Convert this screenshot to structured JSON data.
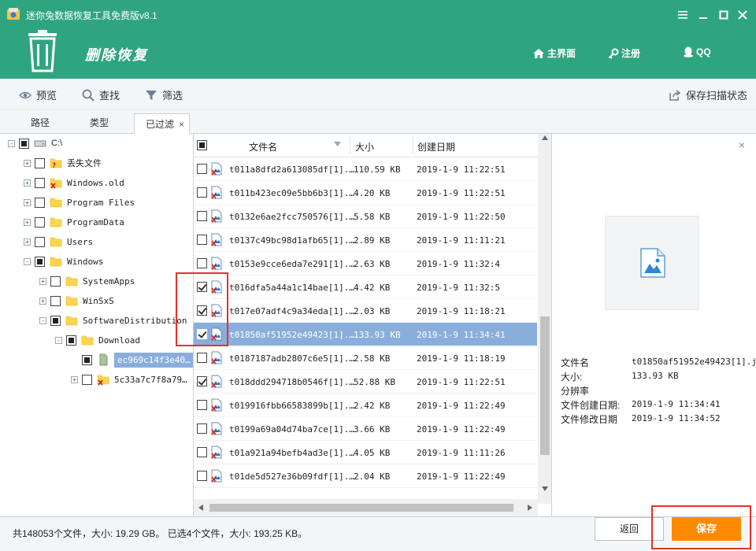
{
  "window": {
    "title": "迷你兔数据恢复工具免费版v8.1",
    "controls": [
      "settings",
      "minimize",
      "maximize",
      "close"
    ]
  },
  "header": {
    "page_title": "删除恢复",
    "nav": [
      {
        "label": "主界面",
        "icon": "home-icon"
      },
      {
        "label": "注册",
        "icon": "key-icon"
      },
      {
        "label": "QQ",
        "icon": "qq-icon"
      }
    ]
  },
  "toolbar": {
    "preview": "预览",
    "find": "查找",
    "filter": "筛选",
    "save_scan": "保存扫描状态"
  },
  "tabs": [
    {
      "label": "路径",
      "active": false
    },
    {
      "label": "类型",
      "active": false
    },
    {
      "label": "已过滤",
      "active": true,
      "closable": "×"
    }
  ],
  "tree": [
    {
      "label": "C:\\",
      "check": "partial",
      "icon": "drive-icon",
      "expander": "-"
    },
    {
      "label": "丢失文件",
      "check": "none",
      "icon": "lost-folder-icon",
      "expander": "+"
    },
    {
      "label": "Windows.old",
      "check": "none",
      "icon": "deleted-folder-icon",
      "expander": "+"
    },
    {
      "label": "Program Files",
      "check": "none",
      "icon": "folder-icon",
      "expander": "+"
    },
    {
      "label": "ProgramData",
      "check": "none",
      "icon": "folder-icon",
      "expander": "+"
    },
    {
      "label": "Users",
      "check": "none",
      "icon": "folder-icon",
      "expander": "+"
    },
    {
      "label": "Windows",
      "check": "partial",
      "icon": "folder-icon",
      "expander": "-"
    },
    {
      "label": "SystemApps",
      "check": "none",
      "icon": "folder-icon",
      "expander": "+"
    },
    {
      "label": "WinSxS",
      "check": "none",
      "icon": "folder-icon",
      "expander": "+"
    },
    {
      "label": "SoftwareDistribution",
      "check": "partial",
      "icon": "folder-icon",
      "expander": "-"
    },
    {
      "label": "Download",
      "check": "partial",
      "icon": "folder-icon",
      "expander": "-"
    },
    {
      "label": "ec969c14f3e40…",
      "check": "partial",
      "icon": "folder-icon",
      "expander": "",
      "selected": true
    },
    {
      "label": "5c33a7c7f8a79…",
      "check": "none",
      "icon": "deleted-folder-icon",
      "expander": "+"
    }
  ],
  "list": {
    "headers": {
      "name": "文件名",
      "size": "大小",
      "date": "创建日期"
    },
    "rows": [
      {
        "name": "t011a8dfd2a613085df[1].…",
        "size": "110.59 KB",
        "date": "2019-1-9  11:22:51",
        "checked": false
      },
      {
        "name": "t011b423ec09e5bb6b3[1].…",
        "size": "4.20 KB",
        "date": "2019-1-9  11:22:51",
        "checked": false
      },
      {
        "name": "t0132e6ae2fcc750576[1].…",
        "size": "5.58 KB",
        "date": "2019-1-9  11:22:50",
        "checked": false
      },
      {
        "name": "t0137c49bc98d1afb65[1].…",
        "size": "2.89 KB",
        "date": "2019-1-9  11:11:21",
        "checked": false
      },
      {
        "name": "t0153e9cce6eda7e291[1].…",
        "size": "2.63 KB",
        "date": "2019-1-9  11:32:4",
        "checked": false
      },
      {
        "name": "t016dfa5a44a1c14bae[1].…",
        "size": "4.42 KB",
        "date": "2019-1-9  11:32:5",
        "checked": true
      },
      {
        "name": "t017e07adf4c9a34eda[1].…",
        "size": "2.03 KB",
        "date": "2019-1-9  11:18:21",
        "checked": true
      },
      {
        "name": "t01850af51952e49423[1].…",
        "size": "133.93 KB",
        "date": "2019-1-9  11:34:41",
        "checked": true,
        "selected": true
      },
      {
        "name": "t0187187adb2807c6e5[1].…",
        "size": "2.58 KB",
        "date": "2019-1-9  11:18:19",
        "checked": false
      },
      {
        "name": "t018ddd294718b0546f[1].…",
        "size": "52.88 KB",
        "date": "2019-1-9  11:22:51",
        "checked": true
      },
      {
        "name": "t019916fbb66583899b[1].…",
        "size": "2.42 KB",
        "date": "2019-1-9  11:22:49",
        "checked": false
      },
      {
        "name": "t0199a69a04d74ba7ce[1].…",
        "size": "3.66 KB",
        "date": "2019-1-9  11:22:49",
        "checked": false
      },
      {
        "name": "t01a921a94befb4ad3e[1].…",
        "size": "4.05 KB",
        "date": "2019-1-9  11:11:26",
        "checked": false
      },
      {
        "name": "t01de5d527e36b09fdf[1].…",
        "size": "2.04 KB",
        "date": "2019-1-9  11:22:49",
        "checked": false
      }
    ]
  },
  "preview": {
    "close": "×",
    "props": [
      {
        "label": "文件名",
        "value": "t01850af51952e49423[1].j"
      },
      {
        "label": "大小:",
        "value": "133.93 KB"
      },
      {
        "label": "分辨率",
        "value": ""
      },
      {
        "label": "文件创建日期:",
        "value": "2019-1-9  11:34:41"
      },
      {
        "label": "文件修改日期",
        "value": "2019-1-9  11:34:52"
      }
    ]
  },
  "status": {
    "summary": "共148053个文件，大小: 19.29 GB。 已选4个文件，大小: 193.25 KB。"
  },
  "buttons": {
    "back": "返回",
    "save": "保存"
  },
  "colors": {
    "brand": "#2fa57f",
    "save": "#ff8a00",
    "selection": "#8aaedc",
    "highlight_box": "#e8302a"
  }
}
